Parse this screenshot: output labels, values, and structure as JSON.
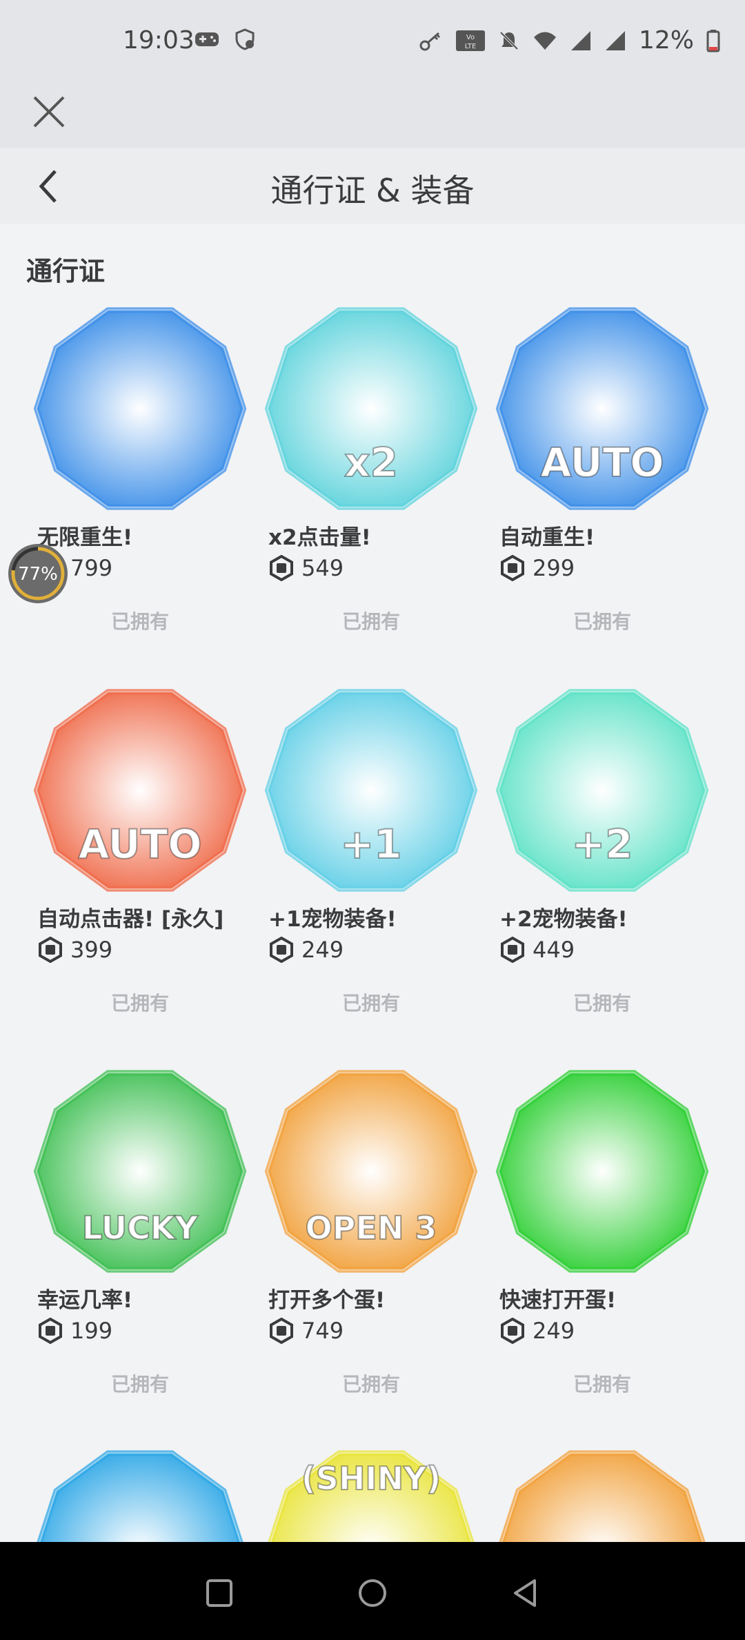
{
  "status_bar": {
    "time": "19:03",
    "battery": "12%",
    "lte_label": "Vo LTE",
    "icons": [
      "gamepad-icon",
      "shield-icon",
      "key-icon",
      "lte-icon",
      "bell-off-icon",
      "wifi-icon",
      "signal-icon",
      "signal-icon",
      "battery-icon"
    ]
  },
  "header": {
    "title": "通行证 & 装备",
    "close_icon": "close-icon",
    "back_icon": "chevron-left-icon"
  },
  "section": {
    "title": "通行证"
  },
  "passes": [
    {
      "name": "无限重生!",
      "price": "799",
      "status": "已拥有",
      "badge_color": "#3d8fe8",
      "badge_text": ""
    },
    {
      "name": "x2点击量!",
      "price": "549",
      "status": "已拥有",
      "badge_color": "#5fd3dc",
      "badge_text": "x2"
    },
    {
      "name": "自动重生!",
      "price": "299",
      "status": "已拥有",
      "badge_color": "#3d8fe8",
      "badge_text": "AUTO"
    },
    {
      "name": "自动点击器! [永久]",
      "price": "399",
      "status": "已拥有",
      "badge_color": "#ef6b4a",
      "badge_text": "AUTO"
    },
    {
      "name": "+1宠物装备!",
      "price": "249",
      "status": "已拥有",
      "badge_color": "#62cfe6",
      "badge_text": "+1"
    },
    {
      "name": "+2宠物装备!",
      "price": "449",
      "status": "已拥有",
      "badge_color": "#5fe2c7",
      "badge_text": "+2"
    },
    {
      "name": "幸运几率!",
      "price": "199",
      "status": "已拥有",
      "badge_color": "#3fbf53",
      "badge_text": "LUCKY"
    },
    {
      "name": "打开多个蛋!",
      "price": "749",
      "status": "已拥有",
      "badge_color": "#f1a13c",
      "badge_text": "OPEN 3"
    },
    {
      "name": "快速打开蛋!",
      "price": "249",
      "status": "已拥有",
      "badge_color": "#2fcf35",
      "badge_text": ""
    }
  ],
  "partial_row": [
    {
      "badge_color": "#2ea7e6",
      "badge_text": ""
    },
    {
      "badge_color": "#e9e43a",
      "badge_text": "(SHINY)"
    },
    {
      "badge_color": "#f1a13c",
      "badge_text": ""
    }
  ],
  "overlay": {
    "progress_text": "77%",
    "progress": 0.77
  },
  "nav_bar": {
    "icons": [
      "recent-apps-icon",
      "home-icon",
      "back-triangle-icon"
    ]
  }
}
